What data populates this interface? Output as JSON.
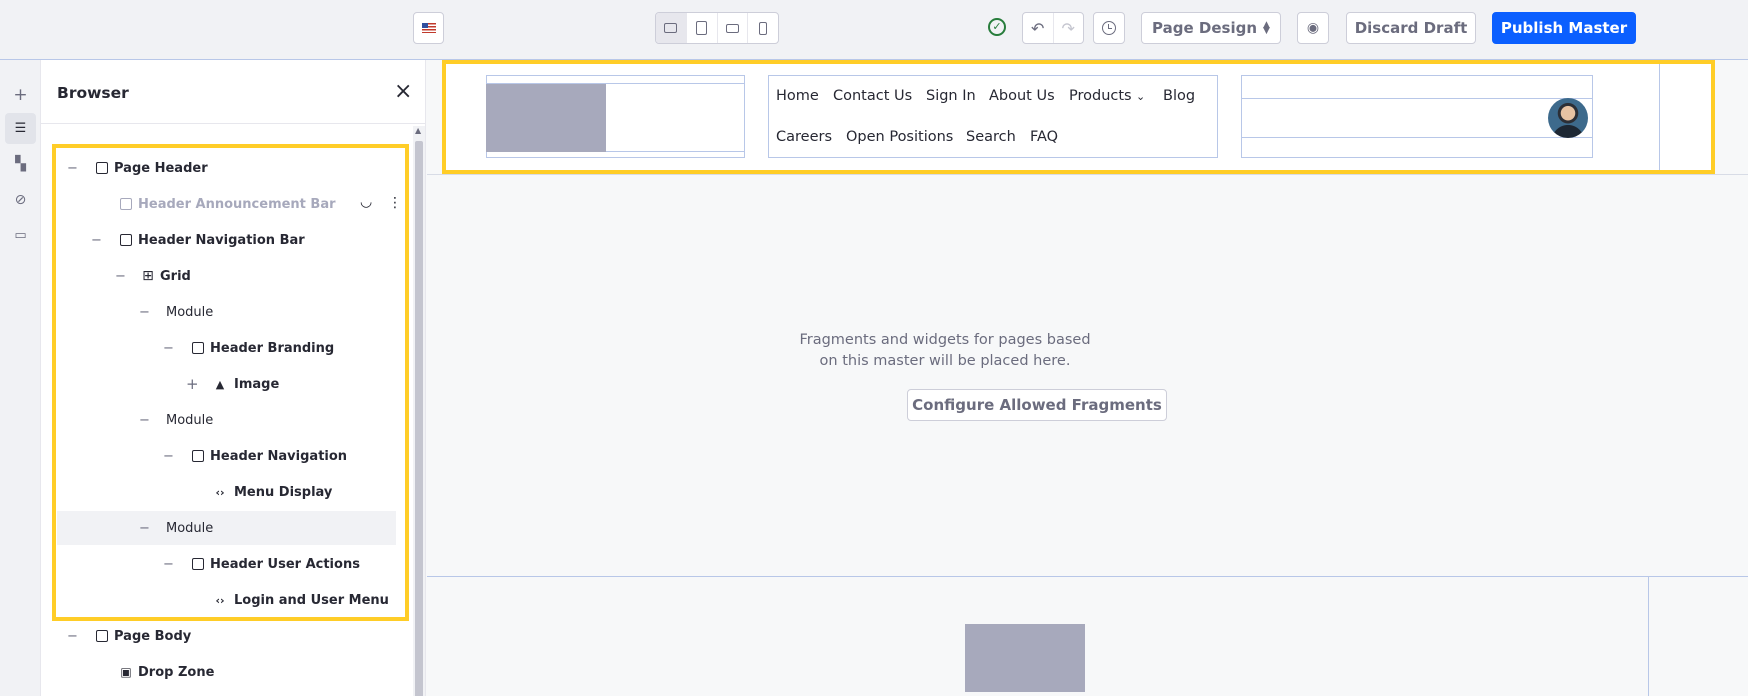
{
  "toolbar": {
    "page_design_label": "Page Design",
    "discard_label": "Discard Draft",
    "publish_label": "Publish Master",
    "save_status": "saved",
    "devices": [
      "desktop",
      "tablet",
      "landscape-phone",
      "portrait-phone"
    ],
    "active_device": "desktop"
  },
  "rail": {
    "items": [
      "add",
      "browser",
      "page-design-options",
      "mapping",
      "comments"
    ],
    "active": "browser"
  },
  "browser": {
    "title": "Browser",
    "tree": [
      {
        "label": "Page Header",
        "icon": "container-icon"
      },
      {
        "label": "Header Announcement Bar",
        "icon": "container-icon",
        "hidden": true
      },
      {
        "label": "Header Navigation Bar",
        "icon": "container-icon"
      },
      {
        "label": "Grid",
        "icon": "grid-icon"
      },
      {
        "label": "Module"
      },
      {
        "label": "Header Branding",
        "icon": "container-icon"
      },
      {
        "label": "Image",
        "icon": "image-icon"
      },
      {
        "label": "Module"
      },
      {
        "label": "Header Navigation",
        "icon": "container-icon"
      },
      {
        "label": "Menu Display",
        "icon": "code-icon"
      },
      {
        "label": "Module"
      },
      {
        "label": "Header User Actions",
        "icon": "container-icon"
      },
      {
        "label": "Login and User Menu",
        "icon": "code-icon"
      },
      {
        "label": "Page Body",
        "icon": "container-icon"
      },
      {
        "label": "Drop Zone",
        "icon": "drop-zone-icon"
      }
    ]
  },
  "canvas": {
    "nav_row1": [
      "Home",
      "Contact Us",
      "Sign In",
      "About Us",
      "Products",
      "Blog"
    ],
    "nav_row2": [
      "Careers",
      "Open Positions",
      "Search",
      "FAQ"
    ],
    "empty_message_line1": "Fragments and widgets for pages based",
    "empty_message_line2": "on this master will be placed here.",
    "configure_label": "Configure Allowed Fragments"
  },
  "colors": {
    "accent": "#0b5fff",
    "highlight": "#ffcd27",
    "placeholder": "#a7a9bc",
    "success": "#287d3c"
  }
}
